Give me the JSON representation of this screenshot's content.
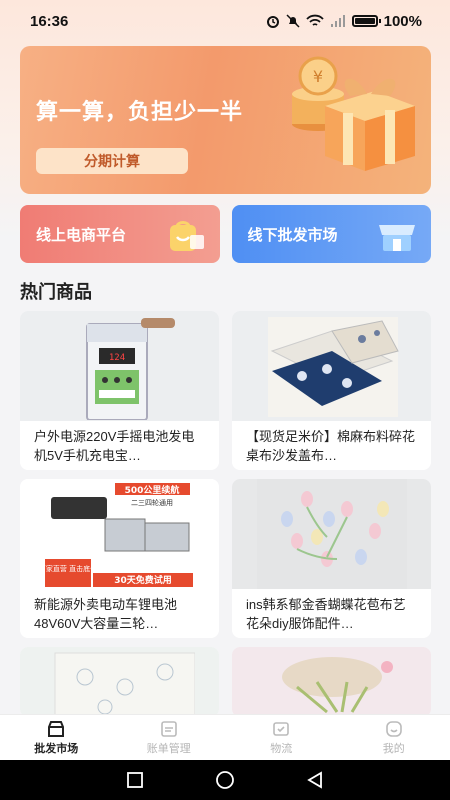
{
  "status_bar": {
    "time": "16:36",
    "battery": "100%"
  },
  "banner": {
    "title": "算一算，负担少一半",
    "button_label": "分期计算"
  },
  "entries": [
    {
      "label": "线上电商平台",
      "icon": "shopping-bag-icon"
    },
    {
      "label": "线下批发市场",
      "icon": "store-icon"
    }
  ],
  "section": {
    "title": "热门商品"
  },
  "products": [
    {
      "name": "户外电源220V手摇电池发电机5V手机充电宝…",
      "display": "124"
    },
    {
      "name": "【现货足米价】棉麻布料碎花桌布沙发盖布…"
    },
    {
      "name": "新能源外卖电动车锂电池48V60V大容量三轮…",
      "headline": "500公里续航",
      "subline": "二三四轮通用",
      "badge": "厂家直营 直击底价",
      "promo": "30天免费试用"
    },
    {
      "name": "ins韩系郁金香蝴蝶花苞布艺花朵diy服饰配件…"
    },
    {
      "name": ""
    },
    {
      "name": ""
    }
  ],
  "tabbar": [
    {
      "label": "批发市场",
      "icon": "wholesale-icon",
      "active": true
    },
    {
      "label": "账单管理",
      "icon": "bill-icon",
      "active": false
    },
    {
      "label": "物流",
      "icon": "logistics-icon",
      "active": false
    },
    {
      "label": "我的",
      "icon": "profile-icon",
      "active": false
    }
  ],
  "colors": {
    "accent": "#f39a6c",
    "online": "#f07c74",
    "offline": "#4f8ff3"
  }
}
